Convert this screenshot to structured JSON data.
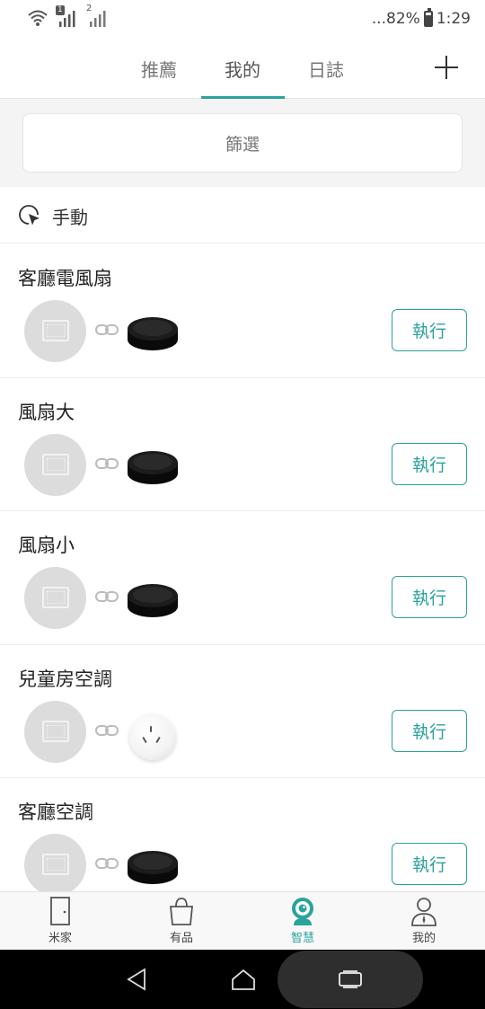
{
  "status_bar": {
    "sim1": "1",
    "sim2": "2",
    "battery": "...82%",
    "time": "1:29"
  },
  "tabs": [
    {
      "label": "推薦",
      "active": false
    },
    {
      "label": "我的",
      "active": true
    },
    {
      "label": "日誌",
      "active": false
    }
  ],
  "add_icon": "plus-icon",
  "filter": {
    "label": "篩選"
  },
  "section": {
    "icon": "cursor-click-icon",
    "label": "手動"
  },
  "scenes": [
    {
      "title": "客廳電風扇",
      "device": "ir-hub",
      "button": "執行"
    },
    {
      "title": "風扇大",
      "device": "ir-hub",
      "button": "執行"
    },
    {
      "title": "風扇小",
      "device": "ir-hub",
      "button": "執行"
    },
    {
      "title": "兒童房空調",
      "device": "smart-plug",
      "button": "執行"
    },
    {
      "title": "客廳空調",
      "device": "ir-hub",
      "button": "執行"
    }
  ],
  "bottom_nav": [
    {
      "label": "米家",
      "icon": "door-icon",
      "active": false
    },
    {
      "label": "有品",
      "icon": "shopping-bag-icon",
      "active": false
    },
    {
      "label": "智慧",
      "icon": "camera-bot-icon",
      "active": true
    },
    {
      "label": "我的",
      "icon": "person-icon",
      "active": false
    }
  ],
  "colors": {
    "accent": "#2ba29b",
    "background": "#f4f4f4"
  }
}
